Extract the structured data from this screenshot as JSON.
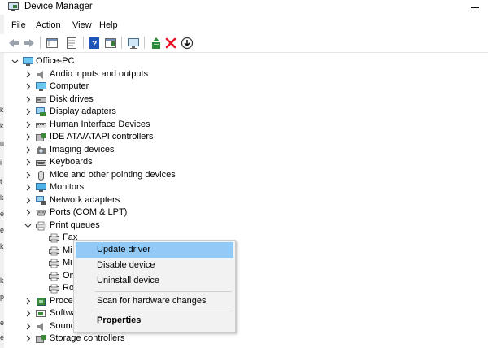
{
  "window": {
    "title": "Device Manager"
  },
  "menu": [
    "File",
    "Action",
    "View",
    "Help"
  ],
  "toolbar": {
    "icons": [
      "back-arrow-icon",
      "forward-arrow-icon",
      "console-tree-icon",
      "properties-icon",
      "help-icon",
      "action-pane-icon",
      "monitor-icon",
      "update-driver-icon",
      "uninstall-x-icon",
      "download-circle-icon"
    ],
    "colors": {
      "uninstall": "#e81123",
      "update": "#2e8b3a",
      "help": "#1e56b8"
    }
  },
  "tree": {
    "root": "Office-PC",
    "categories": [
      {
        "label": "Audio inputs and outputs",
        "icon": "speaker-icon"
      },
      {
        "label": "Computer",
        "icon": "computer-icon"
      },
      {
        "label": "Disk drives",
        "icon": "disk-drive-icon"
      },
      {
        "label": "Display adapters",
        "icon": "display-adapter-icon"
      },
      {
        "label": "Human Interface Devices",
        "icon": "hid-icon"
      },
      {
        "label": "IDE ATA/ATAPI controllers",
        "icon": "ide-controller-icon"
      },
      {
        "label": "Imaging devices",
        "icon": "camera-icon"
      },
      {
        "label": "Keyboards",
        "icon": "keyboard-icon"
      },
      {
        "label": "Mice and other pointing devices",
        "icon": "mouse-icon"
      },
      {
        "label": "Monitors",
        "icon": "monitor-icon"
      },
      {
        "label": "Network adapters",
        "icon": "network-adapter-icon"
      },
      {
        "label": "Ports (COM & LPT)",
        "icon": "port-icon"
      },
      {
        "label": "Print queues",
        "icon": "printer-icon",
        "expanded": true
      }
    ],
    "print_queue_children": [
      "Fax",
      "Mi",
      "Mi",
      "On",
      "Ro"
    ],
    "after": [
      {
        "label": "Proces",
        "icon": "processor-icon"
      },
      {
        "label": "Softwa",
        "icon": "software-device-icon"
      },
      {
        "label": "Sound",
        "icon": "sound-icon"
      },
      {
        "label": "Storage controllers",
        "icon": "storage-controller-icon"
      }
    ]
  },
  "context_menu": {
    "items": [
      "Update driver",
      "Disable device",
      "Uninstall device",
      "Scan for hardware changes",
      "Properties"
    ],
    "highlighted": "Update driver",
    "bold": "Properties",
    "highlight_color": "#91c9f7"
  },
  "left_strip_fragments": [
    "k",
    "k",
    "u",
    "i",
    "t",
    "k",
    "e",
    "e",
    "k",
    "k",
    "p",
    "e",
    "e"
  ]
}
